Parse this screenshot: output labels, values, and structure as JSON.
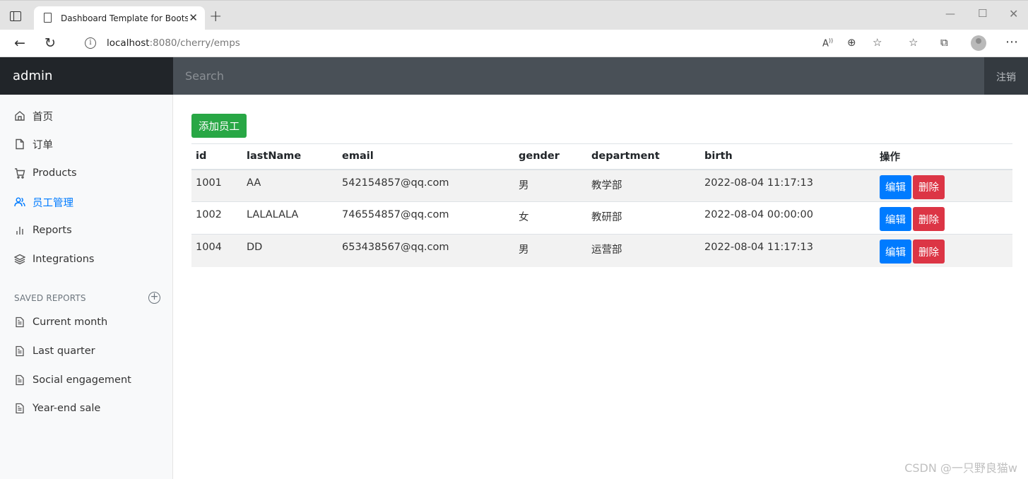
{
  "browser": {
    "tab_title": "Dashboard Template for Bootstrap",
    "url_host": "localhost",
    "url_rest": ":8080/cherry/emps"
  },
  "navbar": {
    "brand": "admin",
    "search_placeholder": "Search",
    "signout_label": "注销"
  },
  "sidebar": {
    "items": [
      {
        "label": "首页",
        "icon": "home-icon"
      },
      {
        "label": "订单",
        "icon": "file-icon"
      },
      {
        "label": "Products",
        "icon": "cart-icon"
      },
      {
        "label": "员工管理",
        "icon": "users-icon",
        "active": true
      },
      {
        "label": "Reports",
        "icon": "bar-chart-icon"
      },
      {
        "label": "Integrations",
        "icon": "layers-icon"
      }
    ],
    "saved_heading": "SAVED REPORTS",
    "saved_items": [
      {
        "label": "Current month"
      },
      {
        "label": "Last quarter"
      },
      {
        "label": "Social engagement"
      },
      {
        "label": "Year-end sale"
      }
    ]
  },
  "main": {
    "add_button": "添加员工",
    "columns": [
      "id",
      "lastName",
      "email",
      "gender",
      "department",
      "birth",
      "操作"
    ],
    "rows": [
      {
        "id": "1001",
        "lastName": "AA",
        "email": "542154857@qq.com",
        "gender": "男",
        "department": "教学部",
        "birth": "2022-08-04 11:17:13"
      },
      {
        "id": "1002",
        "lastName": "LALALALA",
        "email": "746554857@qq.com",
        "gender": "女",
        "department": "教研部",
        "birth": "2022-08-04 00:00:00"
      },
      {
        "id": "1004",
        "lastName": "DD",
        "email": "653438567@qq.com",
        "gender": "男",
        "department": "运营部",
        "birth": "2022-08-04 11:17:13"
      }
    ],
    "edit_label": "编辑",
    "delete_label": "删除"
  },
  "watermark": "CSDN @一只野良猫w",
  "colors": {
    "primary": "#007bff",
    "success": "#28a745",
    "danger": "#dc3545",
    "navbar_dark": "#212529",
    "navbar": "#495057"
  }
}
